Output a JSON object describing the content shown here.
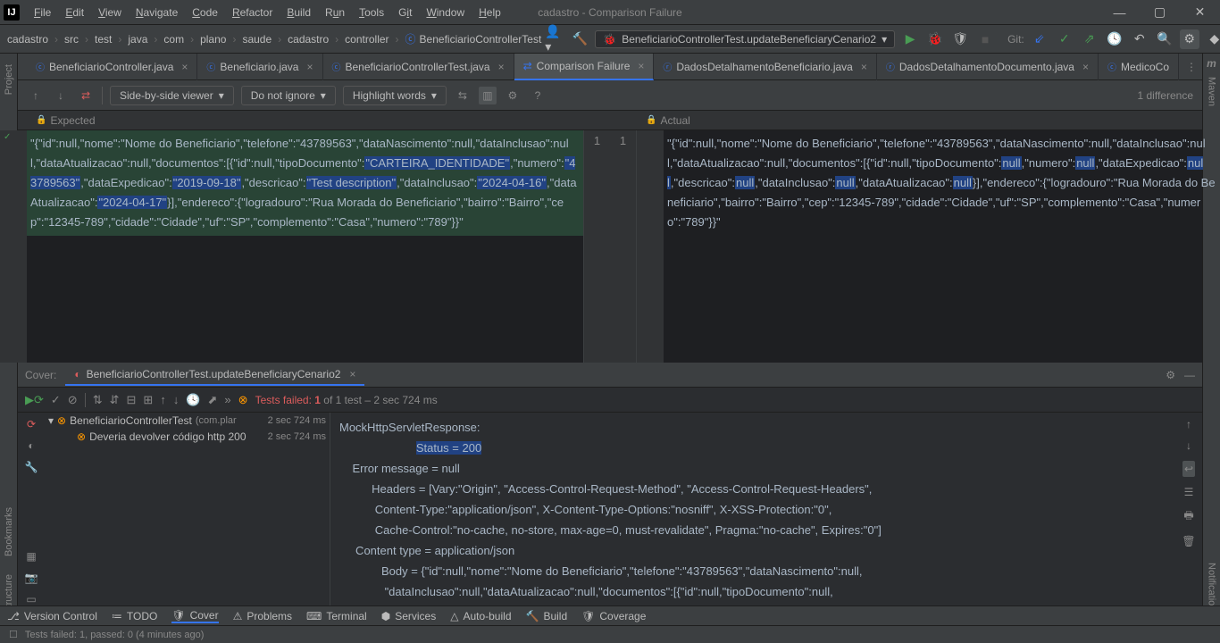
{
  "window_title": "cadastro - Comparison Failure",
  "menu": [
    "File",
    "Edit",
    "View",
    "Navigate",
    "Code",
    "Refactor",
    "Build",
    "Run",
    "Tools",
    "Git",
    "Window",
    "Help"
  ],
  "breadcrumbs": [
    "cadastro",
    "src",
    "test",
    "java",
    "com",
    "plano",
    "saude",
    "cadastro",
    "controller",
    "BeneficiarioControllerTest"
  ],
  "run_config": "BeneficiarioControllerTest.updateBeneficiaryCenario2",
  "git_label": "Git:",
  "tabs": [
    {
      "label": "BeneficiarioController.java"
    },
    {
      "label": "Beneficiario.java"
    },
    {
      "label": "BeneficiarioControllerTest.java"
    },
    {
      "label": "Comparison Failure",
      "active": true
    },
    {
      "label": "DadosDetalhamentoBeneficiario.java"
    },
    {
      "label": "DadosDetalhamentoDocumento.java"
    },
    {
      "label": "MedicoCo"
    }
  ],
  "diff": {
    "viewer_mode": "Side-by-side viewer",
    "ignore_mode": "Do not ignore",
    "highlight_mode": "Highlight words",
    "diff_count": "1 difference",
    "expected_label": "Expected",
    "actual_label": "Actual",
    "line_left": "1",
    "line_right": "1",
    "expected_prefix": "\"{\"id\":null,\"nome\":\"Nome do Beneficiario\",\"telefone\":\"43789563\",\"dataNascimento\":null,\"dataInclusao\":null,\"dataAtualizacao\":null,\"documentos\":[{\"id\":null,\"tipoDocumento\":",
    "expected_h1": "\"CARTEIRA_IDENTIDADE\"",
    "expected_mid1": ",\"numero\":",
    "expected_h2": "\"43789563\"",
    "expected_mid2": ",\"dataExpedicao\":",
    "expected_h3": "\"2019-09-18\"",
    "expected_mid3": ",\"descricao\":",
    "expected_h4": "\"Test description\"",
    "expected_mid4": ",\"dataInclusao\":",
    "expected_h5": "\"2024-04-16\"",
    "expected_mid5": ",\"dataAtualizacao\":",
    "expected_h6": "\"2024-04-17\"",
    "expected_suffix": "}],\"endereco\":{\"logradouro\":\"Rua Morada do Beneficiario\",\"bairro\":\"Bairro\",\"cep\":\"12345-789\",\"cidade\":\"Cidade\",\"uf\":\"SP\",\"complemento\":\"Casa\",\"numero\":\"789\"}}\"",
    "actual_prefix": "\"{\"id\":null,\"nome\":\"Nome do Beneficiario\",\"telefone\":\"43789563\",\"dataNascimento\":null,\"dataInclusao\":null,\"dataAtualizacao\":null,\"documentos\":[{\"id\":null,\"tipoDocumento\":",
    "actual_h1": "null",
    "actual_mid1": ",\"numero\":",
    "actual_h2": "null",
    "actual_mid2": ",\"dataExpedicao\":",
    "actual_h3": "null",
    "actual_mid3": ",\"descricao\":",
    "actual_h4": "null",
    "actual_mid4": ",\"dataInclusao\":",
    "actual_h5": "null",
    "actual_mid5": ",\"dataAtualizacao\":",
    "actual_h6": "null",
    "actual_suffix": "}],\"endereco\":{\"logradouro\":\"Rua Morada do Beneficiario\",\"bairro\":\"Bairro\",\"cep\":\"12345-789\",\"cidade\":\"Cidade\",\"uf\":\"SP\",\"complemento\":\"Casa\",\"numero\":\"789\"}}\""
  },
  "cover": {
    "label": "Cover:",
    "tab": "BeneficiarioControllerTest.updateBeneficiaryCenario2"
  },
  "tests": {
    "status_prefix": "Tests failed:",
    "status_count": "1",
    "status_rest": " of 1 test – 2 sec 724 ms",
    "root": "BeneficiarioControllerTest",
    "root_pkg": "(com.plar",
    "root_time": "2 sec 724 ms",
    "child": "Deveria devolver código http 200",
    "child_time": "2 sec 724 ms"
  },
  "output": {
    "l1": "MockHttpServletResponse:",
    "l2_label": "Status = ",
    "l2_val": "200",
    "l3": "    Error message = null",
    "l4": "          Headers = [Vary:\"Origin\", \"Access-Control-Request-Method\", \"Access-Control-Request-Headers\",",
    "l5": "           Content-Type:\"application/json\", X-Content-Type-Options:\"nosniff\", X-XSS-Protection:\"0\",",
    "l6": "           Cache-Control:\"no-cache, no-store, max-age=0, must-revalidate\", Pragma:\"no-cache\", Expires:\"0\"]",
    "l7": "     Content type = application/json",
    "l8": "             Body = {\"id\":null,\"nome\":\"Nome do Beneficiario\",\"telefone\":\"43789563\",\"dataNascimento\":null,",
    "l9": "              \"dataInclusao\":null,\"dataAtualizacao\":null,\"documentos\":[{\"id\":null,\"tipoDocumento\":null,"
  },
  "bottom_tabs": [
    "Version Control",
    "TODO",
    "Cover",
    "Problems",
    "Terminal",
    "Services",
    "Auto-build",
    "Build",
    "Coverage"
  ],
  "status_msg": "Tests failed: 1, passed: 0 (4 minutes ago)",
  "left_tools": [
    "Project",
    "Bookmarks",
    "Structure"
  ],
  "right_tools": [
    "Maven",
    "Notifications"
  ]
}
